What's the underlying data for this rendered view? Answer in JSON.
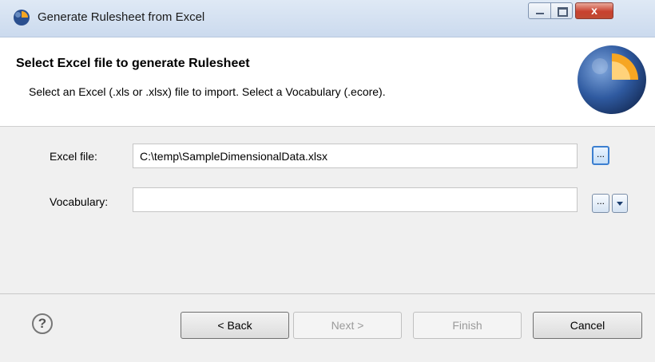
{
  "window": {
    "title": "Generate Rulesheet from Excel",
    "close_glyph": "x"
  },
  "banner": {
    "title": "Select Excel file to generate Rulesheet",
    "description": "Select an Excel (.xls or .xlsx) file to import. Select a Vocabulary (.ecore).",
    "logo_icon": "corticon-logo-icon"
  },
  "form": {
    "excel_label": "Excel file:",
    "excel_value": "C:\\temp\\SampleDimensionalData.xlsx",
    "vocabulary_label": "Vocabulary:",
    "vocabulary_value": "",
    "browse_label": "..."
  },
  "footer": {
    "help_glyph": "?",
    "back_label": "< Back",
    "next_label": "Next >",
    "finish_label": "Finish",
    "cancel_label": "Cancel"
  },
  "colors": {
    "accent": "#3c7fd0",
    "close_red": "#c8412f",
    "logo_blue": "#2a4f8f",
    "logo_orange": "#f6a623"
  }
}
